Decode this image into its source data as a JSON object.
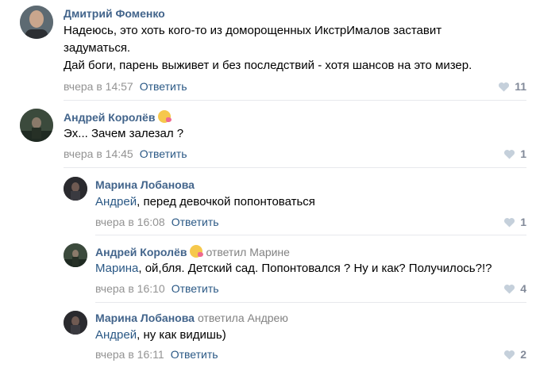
{
  "comments": [
    {
      "author": "Дмитрий Фоменко",
      "lines": [
        "Надеюсь, это хоть кого-то из доморощенных ИкстрИмалов заставит",
        "задуматься.",
        "Дай боги, парень выживет и без последствий - хотя шансов на это мизер."
      ],
      "time": "вчера в 14:57",
      "reply_label": "Ответить",
      "likes": "11"
    },
    {
      "author": "Андрей Королёв",
      "emoji": "tongue-emoji",
      "text": "Эх... Зачем залезал ?",
      "time": "вчера в 14:45",
      "reply_label": "Ответить",
      "likes": "1"
    },
    {
      "author": "Марина Лобанова",
      "mention": "Андрей",
      "text": ", перед девочкой попонтоваться",
      "time": "вчера в 16:08",
      "reply_label": "Ответить",
      "likes": "1"
    },
    {
      "author": "Андрей Королёв",
      "emoji": "tongue-emoji",
      "replied_to": "ответил Марине",
      "mention": "Марина",
      "text": ", ой,бля. Детский сад. Попонтовался ? Ну и как? Получилось?!?",
      "time": "вчера в 16:10",
      "reply_label": "Ответить",
      "likes": "4"
    },
    {
      "author": "Марина Лобанова",
      "replied_to": "ответила Андрею",
      "mention": "Андрей",
      "text": ", ну как видишь)",
      "time": "вчера в 16:11",
      "reply_label": "Ответить",
      "likes": "2"
    }
  ],
  "colors": {
    "name": "#42648b",
    "link": "#2a5885",
    "meta": "#939393",
    "likes": "#828a99",
    "divider": "#e7e8ec"
  }
}
